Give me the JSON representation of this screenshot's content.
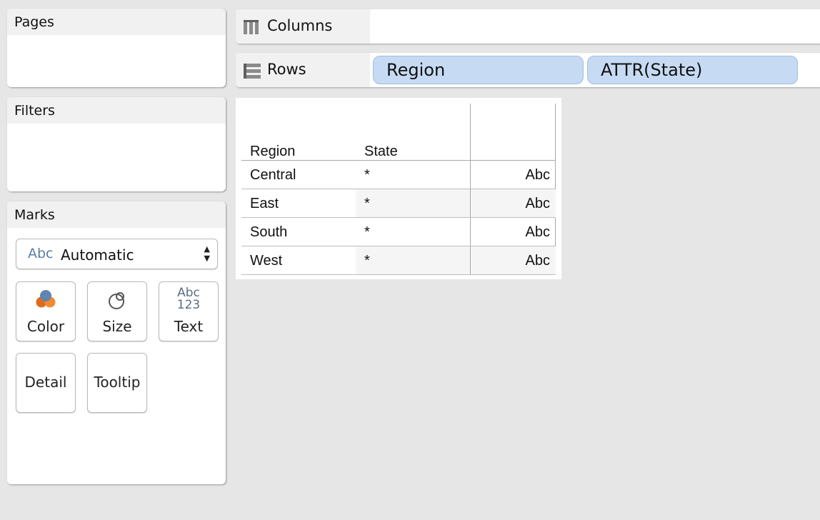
{
  "pages": {
    "title": "Pages"
  },
  "filters": {
    "title": "Filters"
  },
  "marks": {
    "title": "Marks",
    "mark_type": {
      "icon_text": "Abc",
      "value": "Automatic",
      "arrows": "▲▼"
    },
    "buttons": {
      "color": "Color",
      "size": "Size",
      "text": "Text",
      "text_icon_top": "Abc",
      "text_icon_bottom": "123",
      "detail": "Detail",
      "tooltip": "Tooltip"
    }
  },
  "columns": {
    "label": "Columns",
    "pills": []
  },
  "rows": {
    "label": "Rows",
    "pills": [
      "Region",
      "ATTR(State)"
    ]
  },
  "table": {
    "headers": [
      "Region",
      "State",
      ""
    ],
    "rows": [
      {
        "region": "Central",
        "state": "*",
        "value": "Abc"
      },
      {
        "region": "East",
        "state": "*",
        "value": "Abc"
      },
      {
        "region": "South",
        "state": "*",
        "value": "Abc"
      },
      {
        "region": "West",
        "state": "*",
        "value": "Abc"
      }
    ]
  },
  "colors": {
    "pill": "#c6dbf3",
    "pill_border": "#9fbde2",
    "background": "#e6e6e6",
    "band": "#f5f5f5"
  }
}
